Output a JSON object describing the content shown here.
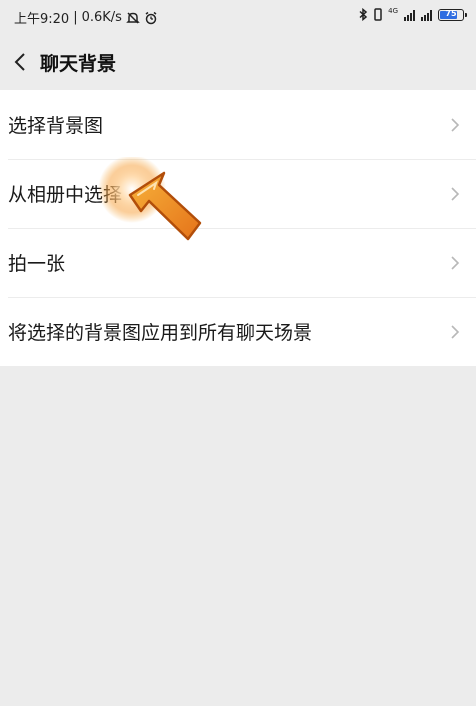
{
  "status_bar": {
    "time": "上午9:20",
    "speed": "0.6K/s",
    "net_type": "4G",
    "battery": "75"
  },
  "header": {
    "title": "聊天背景"
  },
  "menu": {
    "items": [
      {
        "label": "选择背景图"
      },
      {
        "label": "从相册中选择"
      },
      {
        "label": "拍一张"
      },
      {
        "label": "将选择的背景图应用到所有聊天场景"
      }
    ]
  },
  "icons": {
    "back": "chevron-left-icon",
    "row_arrow": "chevron-right-icon",
    "mute": "bell-off-icon",
    "alarm": "alarm-clock-icon",
    "tap": "tap-indicator-arrow"
  },
  "colors": {
    "background": "#ececec",
    "list_bg": "#ffffff",
    "accent_orange": "#f39a1e",
    "battery_fill": "#2f6de1"
  }
}
